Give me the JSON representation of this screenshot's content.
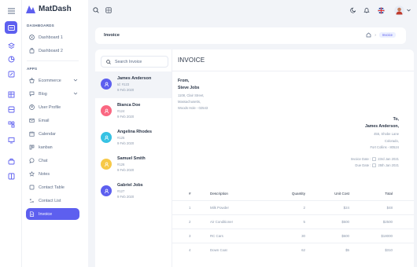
{
  "app": {
    "brand": "MatDash"
  },
  "sidebar": {
    "sections": [
      {
        "title": "DASHBOARDS"
      },
      {
        "title": "APPS"
      }
    ],
    "dashboards": [
      {
        "label": "Dashboard 1",
        "icon": "aperture-icon"
      },
      {
        "label": "Dashboard 2",
        "icon": "shopping-bag-icon"
      }
    ],
    "apps": [
      {
        "label": "Ecommerce",
        "icon": "basket-icon",
        "expandable": true
      },
      {
        "label": "Blog",
        "icon": "chat-icon",
        "expandable": true
      },
      {
        "label": "User Profile",
        "icon": "user-circle-icon"
      },
      {
        "label": "Email",
        "icon": "mail-icon"
      },
      {
        "label": "Calendar",
        "icon": "calendar-icon"
      },
      {
        "label": "kanban",
        "icon": "layout-kanban-icon"
      },
      {
        "label": "Chat",
        "icon": "message-icon"
      },
      {
        "label": "Notes",
        "icon": "notes-icon"
      },
      {
        "label": "Contact Table",
        "icon": "phone-icon"
      },
      {
        "label": "Contact List",
        "icon": "list-details-icon"
      },
      {
        "label": "Invoice",
        "icon": "file-text-icon",
        "active": true
      }
    ]
  },
  "breadcrumb": {
    "title": "Invoice",
    "current": "Invoice"
  },
  "search": {
    "placeholder": "Search Invoice"
  },
  "invoices": [
    {
      "name": "James Anderson",
      "id": "Id: #123",
      "date": "9 Feb 2020",
      "color": "#5d5fef",
      "selected": true
    },
    {
      "name": "Bianca Doe",
      "id": "#124",
      "date": "9 Feb 2020",
      "color": "#fa6781"
    },
    {
      "name": "Angelina Rhodes",
      "id": "#125",
      "date": "9 Feb 2020",
      "color": "#36c2e3"
    },
    {
      "name": "Samuel Smith",
      "id": "#126",
      "date": "9 Feb 2020",
      "color": "#f7c948"
    },
    {
      "name": "Gabriel Jobs",
      "id": "#127",
      "date": "9 Feb 2020",
      "color": "#5d5fef"
    }
  ],
  "detail": {
    "heading": "INVOICE",
    "from_label": "From,",
    "from_name": "Steve Jobs",
    "from_address": [
      "1108, Clair Street,",
      "Massachusetts,",
      "Woods Hole - 02543"
    ],
    "to_label": "To,",
    "to_name": "James Anderson,",
    "to_address": [
      "455, Shobe Lane",
      "Colorado,",
      "Fort Collins - 80524"
    ],
    "invoice_date_label": "Invoice Date :",
    "invoice_date": "23rd Jan 2021",
    "due_date_label": "Due Date :",
    "due_date": "25th Jan 2021"
  },
  "table": {
    "headers": [
      "#",
      "Description",
      "Quantity",
      "Unit Cost",
      "Total"
    ],
    "rows": [
      {
        "num": "1",
        "desc": "Milk Powder",
        "qty": "2",
        "unit": "$24",
        "total": "$48"
      },
      {
        "num": "2",
        "desc": "Air Conditioner",
        "qty": "5",
        "unit": "$500",
        "total": "$2500"
      },
      {
        "num": "3",
        "desc": "RC Cars",
        "qty": "30",
        "unit": "$600",
        "total": "$18000"
      },
      {
        "num": "4",
        "desc": "Down Coat",
        "qty": "62",
        "unit": "$5",
        "total": "$310"
      }
    ]
  },
  "colors": {
    "primary": "#5d5fef",
    "text": "#2a3547",
    "muted": "#8a97ab",
    "bg": "#f2f4f8"
  }
}
